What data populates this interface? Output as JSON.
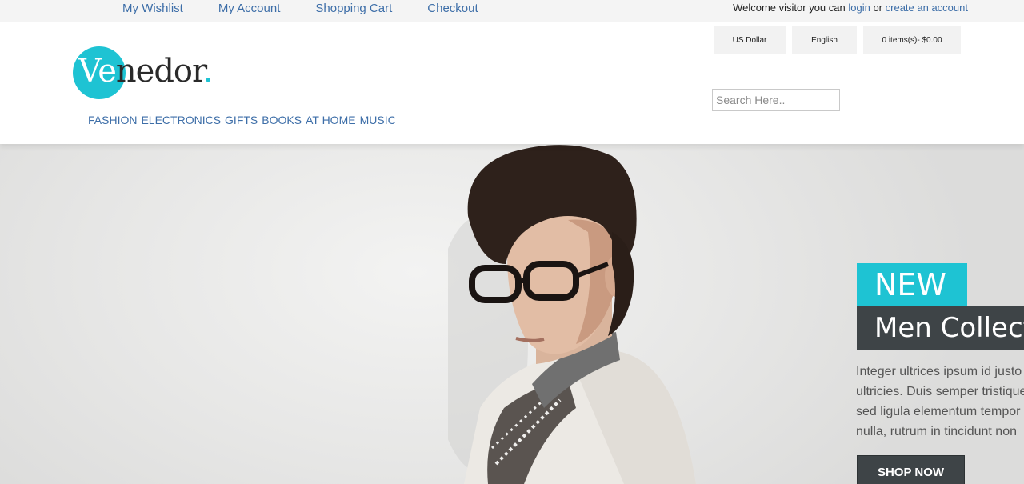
{
  "topbar": {
    "links": [
      "My Wishlist",
      "My Account",
      "Shopping Cart",
      "Checkout"
    ],
    "welcome_prefix": "Welcome visitor you can",
    "login": "login",
    "or": "or",
    "create_account": "create an account"
  },
  "header": {
    "logo": {
      "ve": "Ve",
      "rest": "nedor",
      "dot": "."
    },
    "nav": [
      "FASHION",
      "ELECTRONICS",
      "GIFTS",
      "BOOKS",
      "AT HOME",
      "MUSIC"
    ],
    "currency": "US Dollar",
    "language": "English",
    "cart": "0 items(s)- $0.00",
    "search_placeholder": "Search Here.."
  },
  "hero": {
    "badge": "NEW",
    "title": "Men Collection",
    "copy": [
      "Integer ultrices ipsum id justo",
      "ultricies. Duis semper tristique",
      "sed ligula elementum tempor",
      "nulla, rutrum in tincidunt non"
    ],
    "cta": "SHOP NOW"
  },
  "colors": {
    "accent": "#1ec3d3",
    "dark": "#3e4447",
    "link": "#3d6ea8"
  }
}
